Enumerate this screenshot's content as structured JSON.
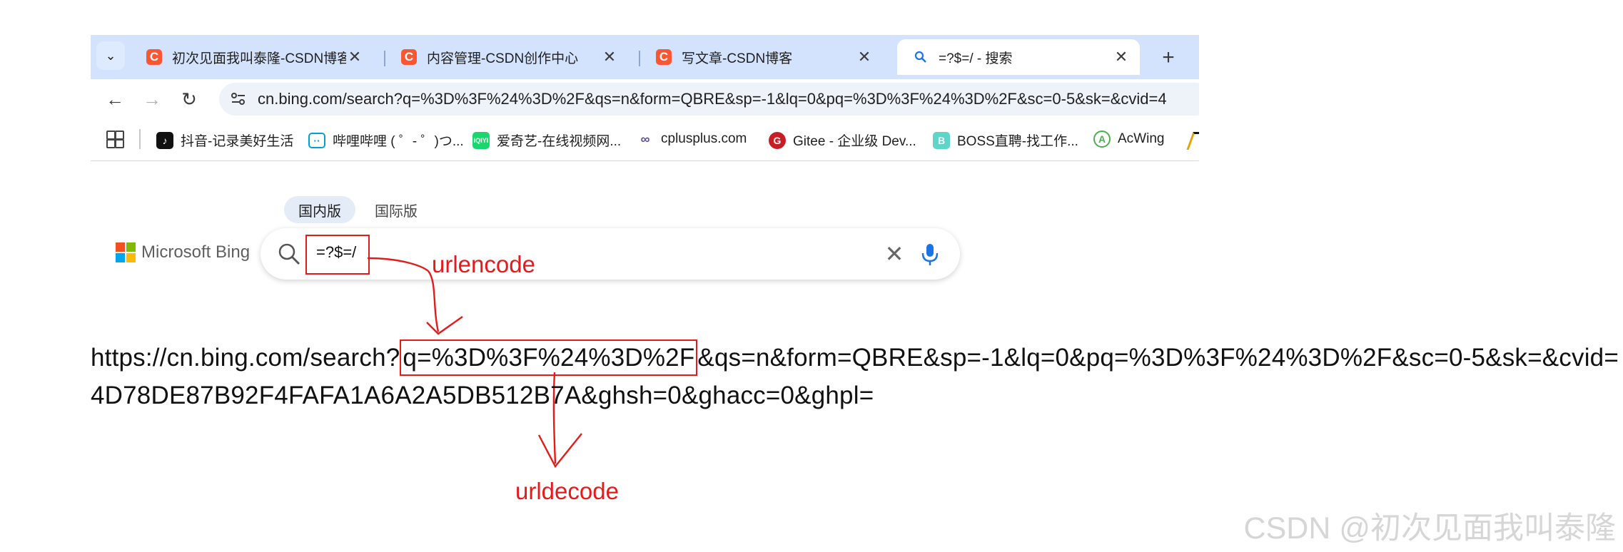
{
  "browser": {
    "tabs": [
      {
        "icon": "C",
        "title": "初次见面我叫泰隆-CSDN博客",
        "active": false
      },
      {
        "icon": "C",
        "title": "内容管理-CSDN创作中心",
        "active": false
      },
      {
        "icon": "C",
        "title": "写文章-CSDN博客",
        "active": false
      },
      {
        "icon": "search-icon",
        "title": "=?$=/ - 搜索",
        "active": true
      }
    ],
    "close_glyph": "✕",
    "url": "cn.bing.com/search?q=%3D%3F%24%3D%2F&qs=n&form=QBRE&sp=-1&lq=0&pq=%3D%3F%24%3D%2F&sc=0-5&sk=&cvid=4",
    "bookmarks": [
      {
        "label": "抖音-记录美好生活",
        "icon": "douyin"
      },
      {
        "label": "哔哩哔哩 ( ゜- ゜)つ...",
        "icon": "bilibili"
      },
      {
        "label": "爱奇艺-在线视频网...",
        "icon": "iqiyi"
      },
      {
        "label": "cplusplus.com",
        "icon": "cplusplus"
      },
      {
        "label": "Gitee - 企业级 Dev...",
        "icon": "gitee"
      },
      {
        "label": "BOSS直聘-找工作...",
        "icon": "boss"
      },
      {
        "label": "AcWing",
        "icon": "acwing"
      }
    ]
  },
  "bing": {
    "scope_tabs": [
      "国内版",
      "国际版"
    ],
    "logo_text": "Microsoft Bing",
    "query": "=?$=/",
    "clear_glyph": "✕"
  },
  "annotations": {
    "encode_label": "urlencode",
    "decode_label": "urldecode"
  },
  "url_text": {
    "line1_pre": "https://cn.bing.com/search?",
    "line1_boxed": "q=%3D%3F%24%3D%2F",
    "line1_post": "&qs=n&form=QBRE&sp=-1&lq=0&pq=%3D%3F%24%3D%2F&sc=0-5&sk=&cvid=",
    "line2": "4D78DE87B92F4FAFA1A6A2A5DB512B7A&ghsh=0&ghacc=0&ghpl="
  },
  "watermark": "CSDN @初次见面我叫泰隆",
  "colors": {
    "tabstrip": "#d3e3fd",
    "csdn_favicon": "#fc5531",
    "annotation_red": "#e41b1b",
    "bing_blue": "#1a73e8"
  }
}
